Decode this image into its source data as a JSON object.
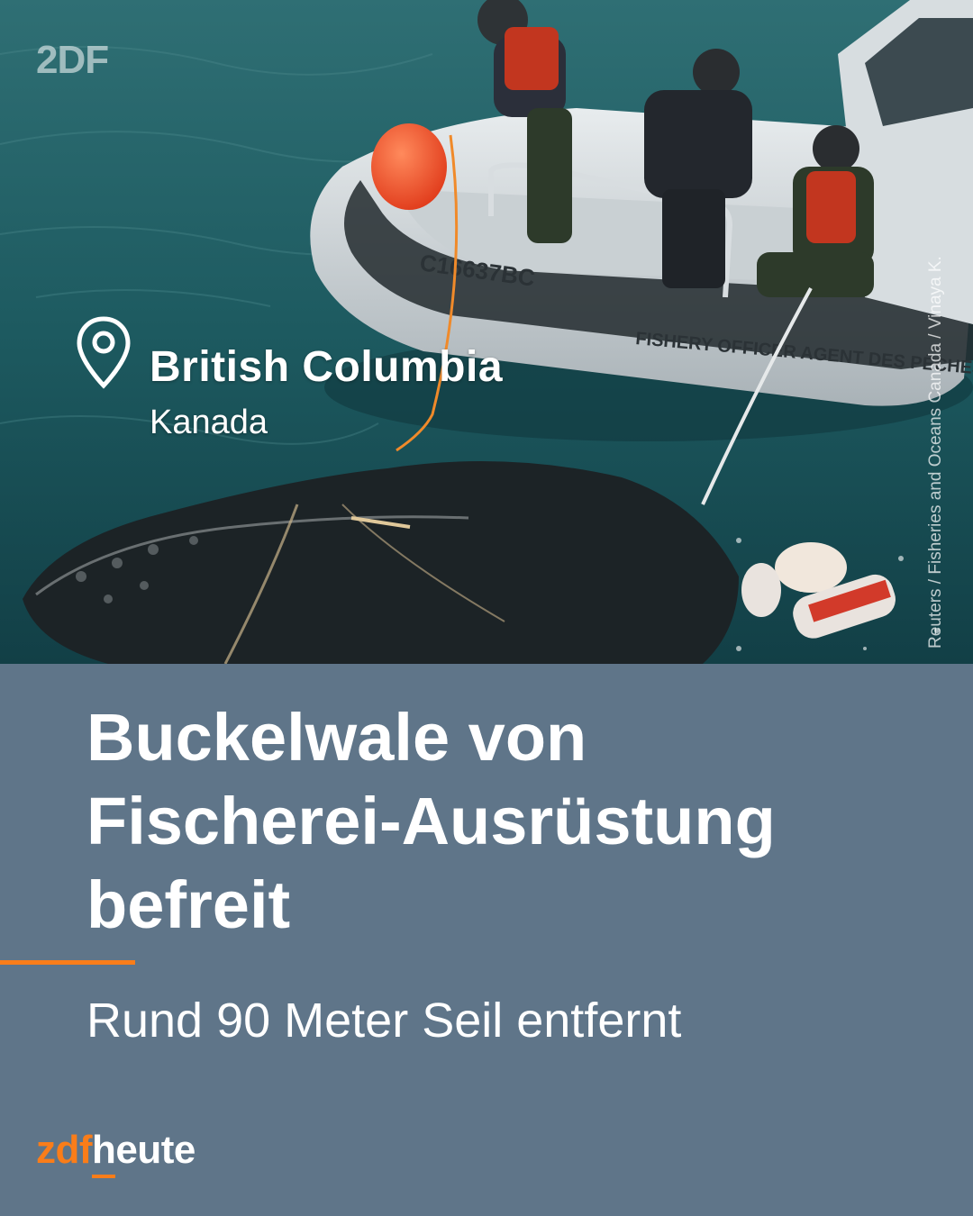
{
  "photo": {
    "boat_registration": "C16637BC",
    "boat_hull_text": "FISHERY OFFICER  AGENT DES PÊCHES",
    "watermark": "2DF",
    "credit": "Reuters / Fisheries and Oceans Canada / Vinaya K."
  },
  "location": {
    "icon": "location-pin-icon",
    "region": "British Columbia",
    "country": "Kanada"
  },
  "headline": {
    "line1": "Buckelwale von",
    "line2": "Fischerei-Ausrüstung",
    "line3": "befreit"
  },
  "subline": "Rund 90 Meter Seil entfernt",
  "logo": {
    "part1": "zdf",
    "part2": "heute"
  },
  "colors": {
    "panel": "#5f7589",
    "accent": "#fa7d19",
    "text": "#ffffff"
  }
}
